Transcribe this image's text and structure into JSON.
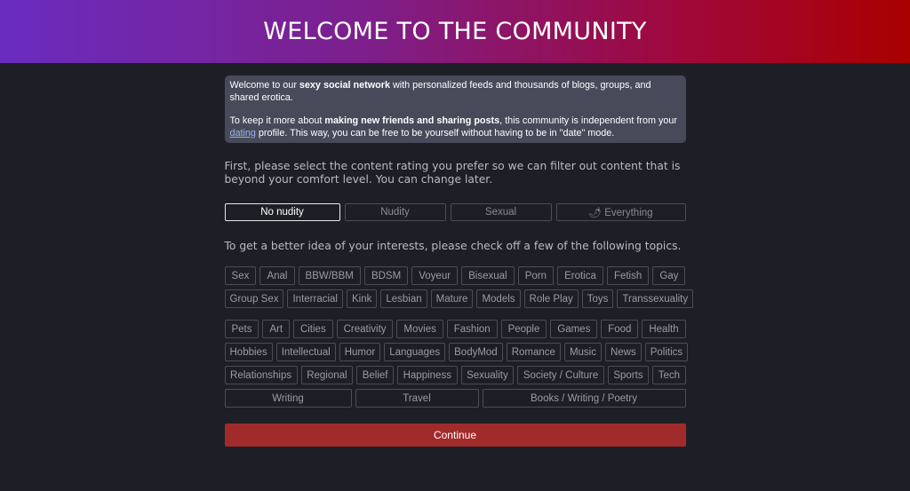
{
  "header": {
    "title": "WELCOME TO THE COMMUNITY"
  },
  "intro": {
    "p1_pre": "Welcome to our ",
    "p1_bold": "sexy social network",
    "p1_post": " with personalized feeds and thousands of blogs, groups, and shared erotica.",
    "p2_pre": "To keep it more about ",
    "p2_bold": "making new friends and sharing posts",
    "p2_mid": ", this community is independent from your ",
    "p2_link": "dating",
    "p2_post": " profile. This way, you can be free to be yourself without having to be in \"date\" mode."
  },
  "rating_prompt": "First, please select the content rating you prefer so we can filter out content that is beyond your comfort level. You can change later.",
  "ratings": [
    {
      "label": "No nudity",
      "selected": true
    },
    {
      "label": "Nudity",
      "selected": false
    },
    {
      "label": "Sexual",
      "selected": false
    },
    {
      "label": "🌶 Everything",
      "selected": false
    }
  ],
  "topics_prompt": "To get a better idea of your interests, please check off a few of the following topics.",
  "adult_topics": [
    [
      "Sex",
      "Anal",
      "BBW/BBM",
      "BDSM",
      "Voyeur",
      "Bisexual",
      "Porn",
      "Erotica",
      "Fetish",
      "Gay"
    ],
    [
      "Group Sex",
      "Interracial",
      "Kink",
      "Lesbian",
      "Mature",
      "Models",
      "Role Play",
      "Toys",
      "Transsexuality"
    ]
  ],
  "general_topics": [
    [
      "Pets",
      "Art",
      "Cities",
      "Creativity",
      "Movies",
      "Fashion",
      "People",
      "Games",
      "Food",
      "Health"
    ],
    [
      "Hobbies",
      "Intellectual",
      "Humor",
      "Languages",
      "BodyMod",
      "Romance",
      "Music",
      "News",
      "Politics"
    ],
    [
      "Relationships",
      "Regional",
      "Belief",
      "Happiness",
      "Sexuality",
      "Society / Culture",
      "Sports",
      "Tech"
    ],
    [
      "Writing",
      "Travel",
      "Books / Writing / Poetry"
    ]
  ],
  "continue_label": "Continue",
  "colors": {
    "background": "#1e1f26",
    "header_gradient_start": "#6a2cbf",
    "header_gradient_end": "#a90000",
    "intro_box": "#464a59",
    "continue_button": "#a12b2b"
  }
}
